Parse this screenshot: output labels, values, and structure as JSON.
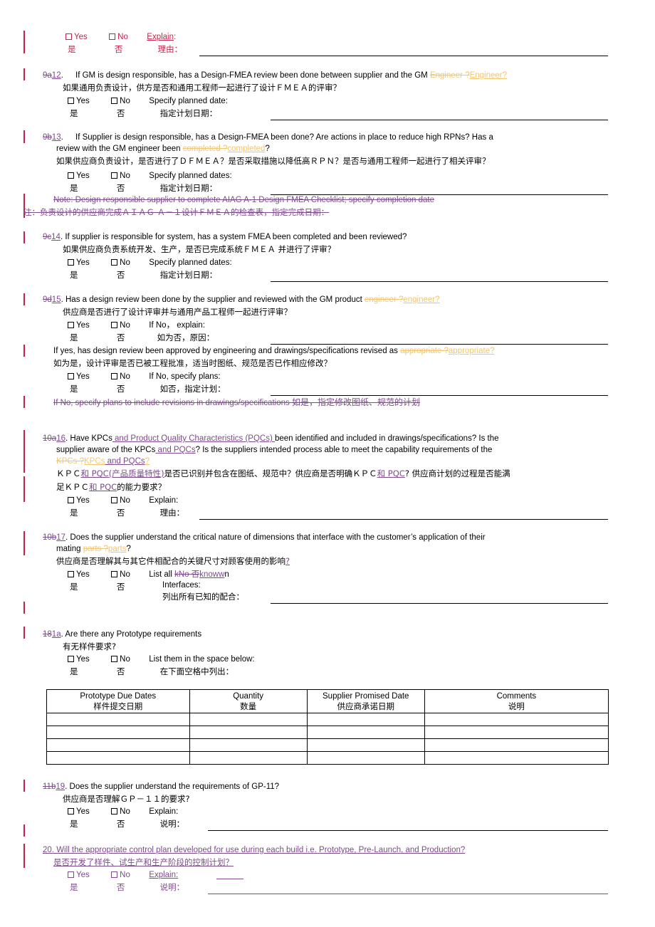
{
  "document": {
    "type": "supplier-quality-assessment-checklist",
    "language": "bilingual-english-chinese",
    "revision_marks": {
      "insertion_gold": "#F2C572",
      "insertion_purple": "#7E4A8D",
      "change_bar": "#C8204A",
      "crimson_text": "#C8204A"
    }
  },
  "q_top": {
    "yes": "Yes",
    "no": "No",
    "yes_zh": "是",
    "no_zh": "否",
    "explain": "Explain",
    "explain_colon": ":",
    "explain_zh": "理由："
  },
  "q9a12": {
    "num_del": "9a",
    "num_ins": "12",
    "num_dot": ".",
    "text_1": "If GM is design responsible, has a Design-FMEA review been done between supplier and the GM ",
    "del": "Engineer ?",
    "ins": "Engineer?",
    "zh": "如果通用负责设计，供方是否和通用工程师一起进行了设计ＦＭＥＡ的评审？",
    "yes": "Yes",
    "no": "No",
    "yes_zh": "是",
    "no_zh": "否",
    "prompt": "Specify planned date:",
    "prompt_zh": "指定计划日期："
  },
  "q9b13": {
    "num_del": "9b",
    "num_ins": "13",
    "num_dot": ".",
    "text_1": "If Supplier is design responsible, has a Design-FMEA been done? Are actions in place to reduce high RPNs? Has a",
    "text_2": "review with the GM engineer been ",
    "del": "completed ?",
    "ins": "completed",
    "tail": "?",
    "zh": "如果供应商负责设计，是否进行了ＤＦＭＥＡ？是否采取措施以降低高ＲＰＮ？是否与通用工程师一起进行了相关评审？",
    "yes": "Yes",
    "no": "No",
    "yes_zh": "是",
    "no_zh": "否",
    "prompt": "Specify planned dates:",
    "prompt_zh": "指定计划日期：",
    "note_en_del": "Note: Design responsible supplier to complete AIAG A-1 Design FMEA Checklist; specify completion date",
    "note_zh_del": "注：负责设计的供应商完成ＡＩＡＧ Ａ－１设计ＦＭＥＡ的检查表，指定完成日期："
  },
  "q9c14": {
    "num_del": "9c",
    "num_ins": "14",
    "num_dot": ".",
    "text_1": "If supplier is responsible for system, has a system FMEA been completed and been reviewed?",
    "zh": "如果供应商负责系统开发、生产，是否已完成系统ＦＭＥＡ 并进行了评审？",
    "yes": "Yes",
    "no": "No",
    "yes_zh": "是",
    "no_zh": "否",
    "prompt": "Specify planned dates:",
    "prompt_zh": "指定计划日期："
  },
  "q9d15": {
    "num_del": "9d",
    "num_ins": "15",
    "num_dot": ".",
    "text_1": "Has a design review been done by the supplier and reviewed with the GM product ",
    "del": "engineer ?",
    "ins": "engineer?",
    "zh": "供应商是否进行了设计评审并与通用产品工程师一起进行评审？",
    "yes": "Yes",
    "no": "No",
    "yes_zh": "是",
    "no_zh": "否",
    "prompt": "If No， explain:",
    "prompt_zh": "如为否，原因：",
    "sub_text": "If yes, has design review been approved by engineering and drawings/specifications revised as ",
    "sub_del": "appropriate ?",
    "sub_ins": "appropriate?",
    "sub_zh": "如为是，设计评审是否已被工程批准，适当时图纸、规范是否已作相应修改？",
    "sub_yes": "Yes",
    "sub_no": "No",
    "sub_yes_zh": "是",
    "sub_no_zh": "否",
    "sub_prompt": "If No, specify plans:",
    "sub_prompt_zh": "如否，指定计划：",
    "del_line_en": "If No, specify plans to include revisions in drawings/specifications ",
    "del_line_zh": "如是，指定修改图纸、规范的计划"
  },
  "q10a16": {
    "num_del": "10a",
    "num_ins": "16",
    "num_dot": ".",
    "t1": "Have KPCs",
    "ins1": " and Product Quality Characteristics (PQCs) ",
    "t2": "been identified and included in drawings/specifications?  Is the",
    "t3": "supplier aware of the KPCs",
    "ins2": " and PQCs",
    "t4": "?  Is the suppliers intended process able to meet the capability requirements of the",
    "del3": "KPCs ?",
    "ins3": "KPCs",
    "ins4": " and PQCs",
    "ins5": "?",
    "zh1a": "ＫＰＣ",
    "zh1ins": "和 PQC",
    "zh1ins2": "(产品质量特性)",
    "zh1b": "是否已识别并包含在图纸、规范中？供应商是否明确ＫＰＣ",
    "zh1c": "和 PQC",
    "zh1d": "? 供应商计划的过程是否能满",
    "zh2a": "足ＫＰＣ",
    "zh2ins": "和 PQC",
    "zh2b": "的能力要求？",
    "yes": "Yes",
    "no": "No",
    "yes_zh": "是",
    "no_zh": "否",
    "prompt": "Explain:",
    "prompt_zh": "理由："
  },
  "q10b17": {
    "num_del": "10b",
    "num_ins": "17",
    "num_dot": ".",
    "t1": "Does the supplier understand the critical nature of dimensions that interface with the customer’s application of their",
    "t2": "mating ",
    "del": "parts ?",
    "ins": "parts",
    "tail": "?",
    "zh": "供应商是否理解其与其它件相配合的关键尺寸对顾客使用的影响",
    "zh_ins_q": "?",
    "yes": "Yes",
    "no": "No",
    "yes_zh": "是",
    "no_zh": "否",
    "list_all": "List all ",
    "list_del": "kNo 否",
    "list_ins": "knoww",
    "list_tail": "n",
    "interfaces": "Interfaces:",
    "interfaces_zh": "列出所有已知的配合："
  },
  "q18_1a": {
    "num_del": "18",
    "num_ins": "1a",
    "num_dot": ".",
    "t1": "Are there any Prototype requirements",
    "zh": "有无样件要求?",
    "yes": "Yes",
    "no": "No",
    "yes_zh": "是",
    "no_zh": "否",
    "prompt": "List them in the space below:",
    "prompt_zh": "在下面空格中列出：",
    "table": {
      "headers_en": [
        "Prototype Due Dates",
        "Quantity",
        "Supplier Promised Date",
        "Comments"
      ],
      "headers_zh": [
        "样件提交日期",
        "数量",
        "供应商承诺日期",
        "说明"
      ],
      "rows": [
        [
          "",
          "",
          "",
          ""
        ],
        [
          "",
          "",
          "",
          ""
        ],
        [
          "",
          "",
          "",
          ""
        ],
        [
          "",
          "",
          "",
          ""
        ]
      ]
    }
  },
  "q11b19": {
    "num_del": "11b",
    "num_ins": "19",
    "num_dot": ".",
    "t1": "Does the supplier understand the requirements of GP-11?",
    "zh": "供应商是否理解ＧＰ－１１的要求?",
    "yes": "Yes",
    "no": "No",
    "yes_zh": "是",
    "no_zh": "否",
    "prompt": "Explain:",
    "prompt_zh": "说明："
  },
  "q20": {
    "num": "20.",
    "t1": " Will the appropriate control plan developed for use during each build i.e. Prototype, Pre-Launch, and Production?",
    "zh": "是否开发了样件、试生产和生产阶段的控制计划？",
    "yes": "Yes",
    "no": "No",
    "yes_zh": "是",
    "no_zh": "否",
    "prompt": "Explain:",
    "prompt_zh": "说明："
  }
}
